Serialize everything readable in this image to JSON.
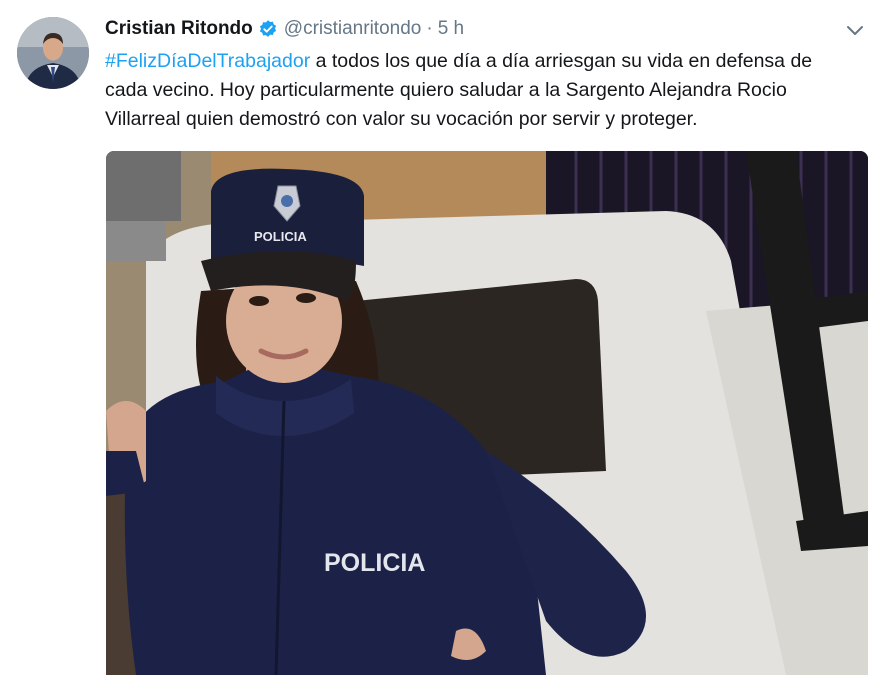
{
  "tweet": {
    "author_name": "Cristian Ritondo",
    "handle": "@cristianritondo",
    "separator": "·",
    "time": "5 h",
    "hashtag": "#FelizDíaDelTrabajador",
    "line1_rest": " a todos los que día a día arriesgan su vida en defensa de",
    "line2": "cada vecino. Hoy particularmente quiero saludar a la Sargento Alejandra Rocio",
    "line3": "Villarreal quien demostró con valor su vocación por servir y proteger.",
    "icons": {
      "verified": "verified-badge-icon",
      "caret": "chevron-down-icon"
    },
    "photo": {
      "cap_text": "POLICIA",
      "jacket_text": "POLICIA"
    },
    "colors": {
      "hashtag": "#1da1f2",
      "verified": "#1da1f2",
      "secondary_text": "#657786",
      "uniform": "#1c2247"
    }
  }
}
